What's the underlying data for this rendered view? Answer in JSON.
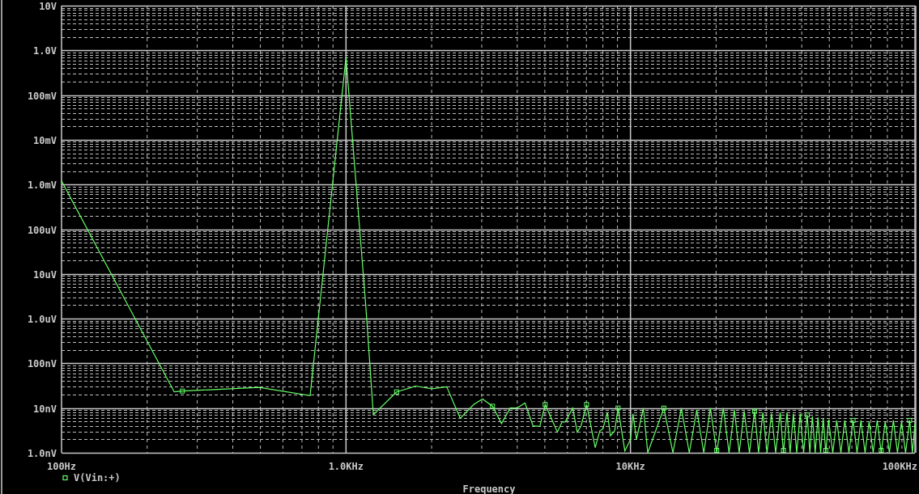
{
  "plot": {
    "y_axis_labels": [
      "10V",
      "1.0V",
      "100mV",
      "10mV",
      "1.0mV",
      "100uV",
      "10uV",
      "1.0uV",
      "100nV",
      "10nV",
      "1.0nV"
    ],
    "x_axis_labels": [
      "100Hz",
      "1.0KHz",
      "10KHz",
      "100KHz"
    ],
    "x_axis_title": "Frequency",
    "legend": [
      {
        "name": "V(Vin:+)"
      }
    ]
  }
}
